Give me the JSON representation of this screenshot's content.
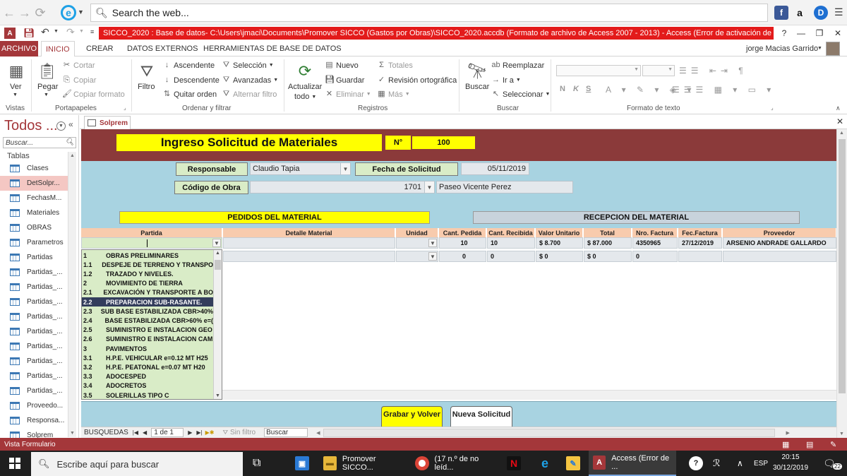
{
  "browser": {
    "search_placeholder": "Search the web..."
  },
  "title_bar": {
    "title": "SICCO_2020 : Base de datos- C:\\Users\\jmaci\\Documents\\Promover SICCO (Gastos por Obras)\\SICCO_2020.accdb (Formato de archivo de Access 2007 - 2013) -  Access (Error de activación de productos)",
    "help": "?"
  },
  "ribbon": {
    "tabs": [
      "ARCHIVO",
      "INICIO",
      "CREAR",
      "DATOS EXTERNOS",
      "HERRAMIENTAS DE BASE DE DATOS"
    ],
    "user": "jorge Macias Garrido",
    "vistas": {
      "ver": "Ver",
      "label": "Vistas"
    },
    "portapapeles": {
      "pegar": "Pegar",
      "cortar": "Cortar",
      "copiar": "Copiar",
      "copiar_formato": "Copiar formato",
      "label": "Portapapeles"
    },
    "ordenar": {
      "filtro": "Filtro",
      "ascendente": "Ascendente",
      "descendente": "Descendente",
      "quitar_orden": "Quitar orden",
      "seleccion": "Selección",
      "avanzadas": "Avanzadas",
      "alternar_filtro": "Alternar filtro",
      "label": "Ordenar y filtrar"
    },
    "registros": {
      "actualizar": "Actualizar",
      "todo": "todo",
      "nuevo": "Nuevo",
      "guardar": "Guardar",
      "eliminar": "Eliminar",
      "totales": "Totales",
      "revision": "Revisión ortográfica",
      "mas": "Más",
      "label": "Registros"
    },
    "buscar": {
      "buscar": "Buscar",
      "reemplazar": "Reemplazar",
      "ir_a": "Ir a",
      "seleccionar": "Seleccionar",
      "label": "Buscar"
    },
    "formato": {
      "bold": "N",
      "italic": "K",
      "underline": "S",
      "label": "Formato de texto"
    }
  },
  "nav_pane": {
    "title": "Todos ...",
    "search_placeholder": "Buscar...",
    "section": "Tablas",
    "items": [
      "Clases",
      "DetSolpr...",
      "FechasM...",
      "Materiales",
      "OBRAS",
      "Parametros",
      "Partidas",
      "Partidas_...",
      "Partidas_...",
      "Partidas_...",
      "Partidas_...",
      "Partidas_...",
      "Partidas_...",
      "Partidas_...",
      "Partidas_...",
      "Partidas_...",
      "Proveedo...",
      "Responsa...",
      "Solprem"
    ]
  },
  "doc_tab": {
    "label": "Solprem"
  },
  "form": {
    "title": "Ingreso Solicitud de Materiales",
    "num_label": "N°",
    "num_value": "100",
    "responsable_label": "Responsable",
    "responsable_value": "Claudio Tapia",
    "fecha_label": "Fecha de Solicitud",
    "fecha_value": "05/11/2019",
    "obra_label": "Código de Obra",
    "obra_code": "1701",
    "obra_name": "Paseo Vicente Perez",
    "pedidos_label": "PEDIDOS DEL MATERIAL",
    "recepcion_label": "RECEPCION DEL MATERIAL"
  },
  "grid": {
    "headers": [
      "Partida",
      "Detalle Material",
      "Unidad",
      "Cant. Pedida",
      "Cant. Recibida",
      "Valor Unitario",
      "Total",
      "Nro. Factura",
      "Fec.Factura",
      "Proveedor"
    ],
    "rows": [
      {
        "cant_pedida": "10",
        "cant_recibida": "10",
        "valor_unitario": "$ 8.700",
        "total": "$ 87.000",
        "nro_factura": "4350965",
        "fec_factura": "27/12/2019",
        "proveedor": "ARSENIO ANDRADE GALLARDO"
      },
      {
        "cant_pedida": "0",
        "cant_recibida": "0",
        "valor_unitario": "$ 0",
        "total": "$ 0",
        "nro_factura": "0",
        "fec_factura": "",
        "proveedor": ""
      }
    ]
  },
  "dropdown": {
    "items": [
      {
        "code": "1",
        "name": "OBRAS PRELIMINARES"
      },
      {
        "code": "1.1",
        "name": "DESPEJE DE TERRENO Y TRANSPO"
      },
      {
        "code": "1.2",
        "name": "TRAZADO Y NIVELES."
      },
      {
        "code": "2",
        "name": "MOVIMIENTO DE TIERRA"
      },
      {
        "code": "2.1",
        "name": "EXCAVACIÓN Y TRANSPORTE A BO"
      },
      {
        "code": "2.2",
        "name": "PREPARACION SUB-RASANTE."
      },
      {
        "code": "2.3",
        "name": "SUB BASE ESTABILIZADA CBR>40%"
      },
      {
        "code": "2.4",
        "name": "BASE ESTABILIZADA CBR>60% e=("
      },
      {
        "code": "2.5",
        "name": "SUMINISTRO E INSTALACION GEO"
      },
      {
        "code": "2.6",
        "name": "SUMINISTRO E INSTALACION CAM"
      },
      {
        "code": "3",
        "name": "PAVIMENTOS"
      },
      {
        "code": "3.1",
        "name": "H.P.E. VEHICULAR e=0.12 MT H25"
      },
      {
        "code": "3.2",
        "name": "H.P.E. PEATONAL e=0.07 MT H20"
      },
      {
        "code": "3.3",
        "name": "ADOCESPED"
      },
      {
        "code": "3.4",
        "name": "ADOCRETOS"
      },
      {
        "code": "3.5",
        "name": "SOLERILLAS TIPO C"
      }
    ],
    "selected_index": 5
  },
  "footer": {
    "grabar": "Grabar y Volver",
    "nueva": "Nueva Solicitud"
  },
  "record_nav": {
    "label": "BUSQUEDAS",
    "position": "1 de 1",
    "filter": "Sin filtro",
    "search": "Buscar"
  },
  "status": {
    "text": "Vista Formulario"
  },
  "taskbar": {
    "search": "Escribe aquí para buscar",
    "items": [
      "Promover SICCO...",
      "(17 n.º de no leíd...",
      "Access (Error de ..."
    ],
    "lang": "ESP",
    "time": "20:15",
    "date": "30/12/2019",
    "notif": "22"
  },
  "colors": {
    "access_red": "#a4373a",
    "header_brown": "#8b3a3a",
    "form_blue": "#a8d3e1",
    "yellow": "#ffff00",
    "label_green": "#d9ecc7"
  }
}
